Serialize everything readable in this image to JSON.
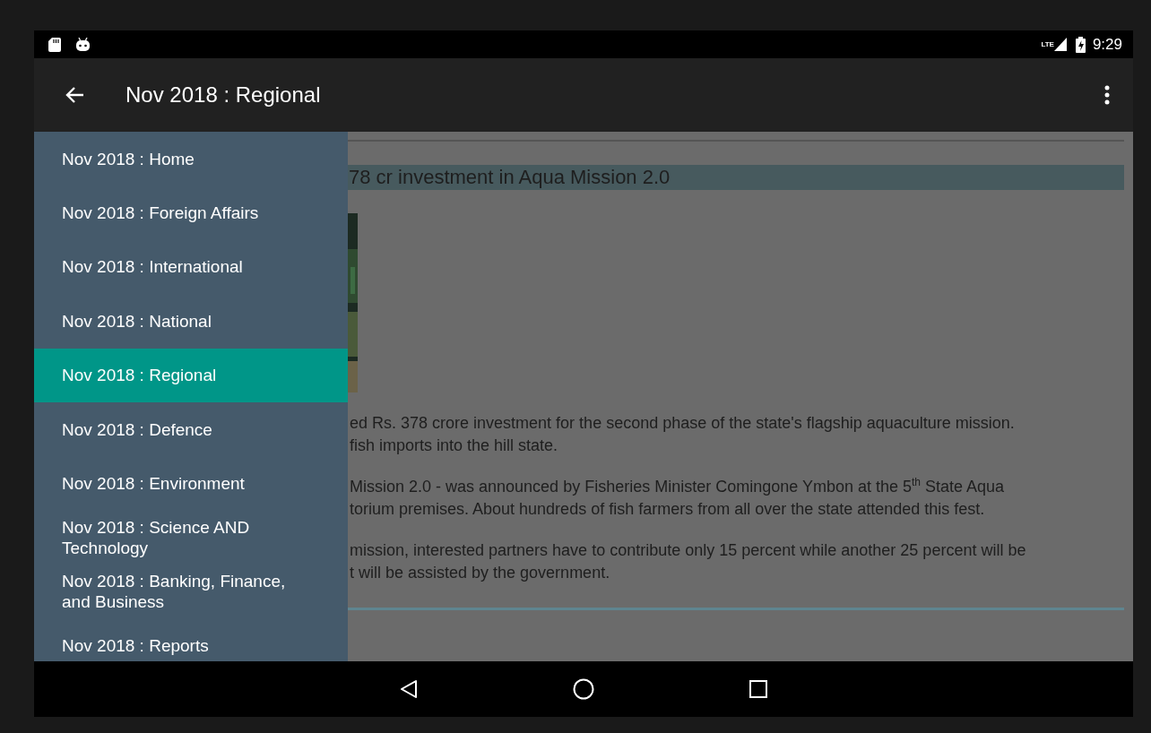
{
  "status_bar": {
    "network": "LTE",
    "time": "9:29"
  },
  "app_bar": {
    "title": "Nov 2018 : Regional"
  },
  "drawer": {
    "items": [
      {
        "label": "Nov 2018 : Home",
        "selected": false
      },
      {
        "label": "Nov 2018 : Foreign Affairs",
        "selected": false
      },
      {
        "label": "Nov 2018 : International",
        "selected": false
      },
      {
        "label": "Nov 2018 : National",
        "selected": false
      },
      {
        "label": "Nov 2018 : Regional",
        "selected": true
      },
      {
        "label": "Nov 2018 : Defence",
        "selected": false
      },
      {
        "label": "Nov 2018 : Environment",
        "selected": false
      },
      {
        "label": "Nov 2018 : Science AND Technology",
        "selected": false
      },
      {
        "label": "Nov 2018 : Banking, Finance, and Business",
        "selected": false
      },
      {
        "label": "Nov 2018 : Reports",
        "selected": false
      }
    ]
  },
  "article": {
    "headline": "78 cr investment in Aqua Mission 2.0",
    "paragraphs": [
      {
        "lines": [
          "ed Rs. 378 crore investment for the second phase of the state's flagship aquaculture mission.",
          "fish imports into the hill state."
        ]
      },
      {
        "lines": [
          "Mission 2.0 - was announced by Fisheries Minister Comingone Ymbon at the 5$^{th}$ State Aqua",
          "torium premises. About hundreds of fish farmers from all over the state attended this fest."
        ]
      },
      {
        "lines": [
          "mission, interested partners have to contribute only 15 percent while another 25 percent will be",
          "t will be assisted by the government."
        ]
      }
    ]
  }
}
